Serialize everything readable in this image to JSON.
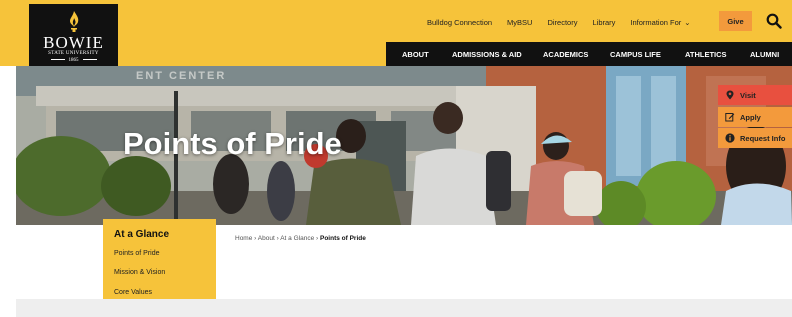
{
  "logo": {
    "name": "BOWIE",
    "subtitle": "STATE UNIVERSITY",
    "year": "1865"
  },
  "utility_nav": [
    "Bulldog Connection",
    "MyBSU",
    "Directory",
    "Library",
    "Information For"
  ],
  "give_label": "Give",
  "main_nav": [
    "ABOUT",
    "ADMISSIONS & AID",
    "ACADEMICS",
    "CAMPUS LIFE",
    "ATHLETICS",
    "ALUMNI"
  ],
  "hero": {
    "title": "Points of Pride",
    "building_sign": "ENT CENTER"
  },
  "cta": {
    "visit": "Visit",
    "apply": "Apply",
    "request_info": "Request Info"
  },
  "at_a_glance": {
    "title": "At a Glance",
    "items": [
      "Points of Pride",
      "Mission & Vision",
      "Core Values"
    ]
  },
  "breadcrumb": {
    "items": [
      "Home",
      "About",
      "At a Glance"
    ],
    "current": "Points of Pride",
    "separator": "›"
  },
  "colors": {
    "gold": "#f6c33a",
    "black": "#111111",
    "orange": "#f39a3c",
    "red": "#e8503f"
  }
}
